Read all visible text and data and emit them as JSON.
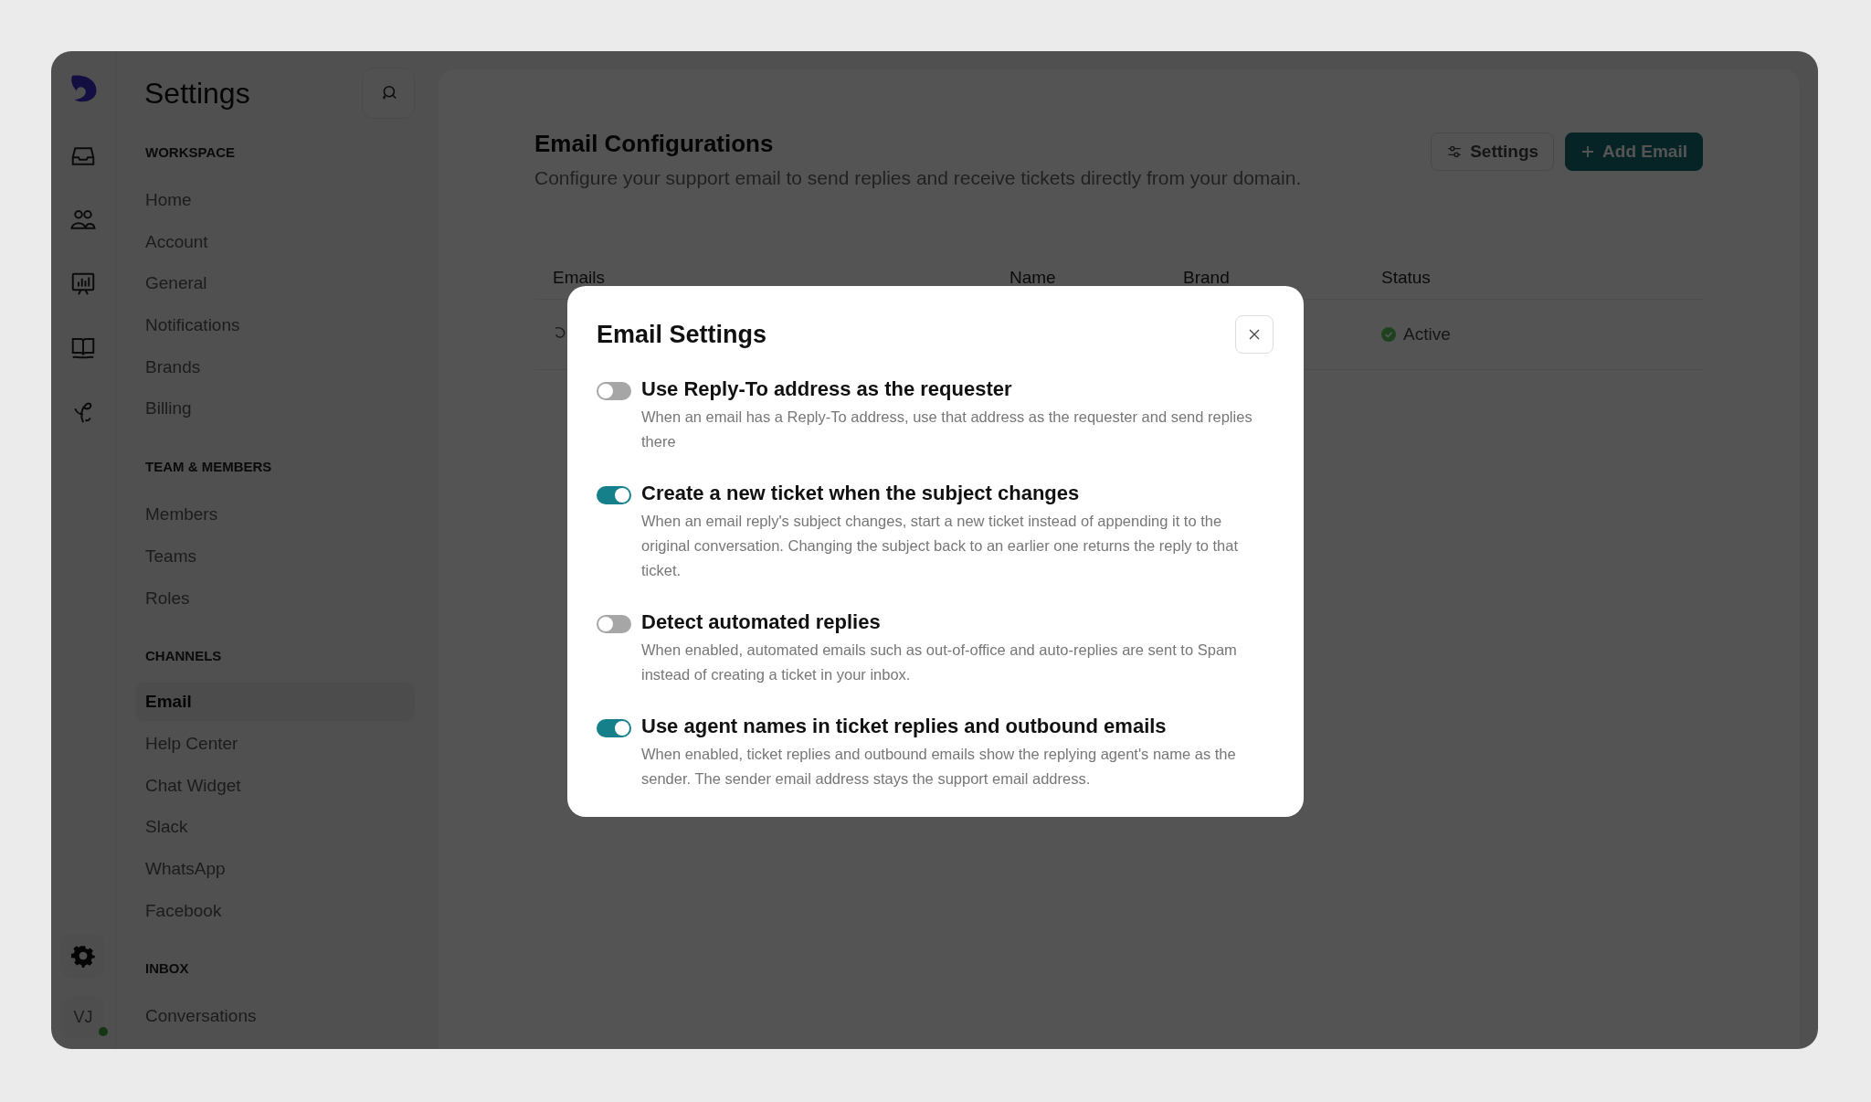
{
  "rail": {
    "avatar": "VJ"
  },
  "sidebar": {
    "title": "Settings",
    "sections": [
      {
        "heading": "WORKSPACE",
        "items": [
          {
            "label": "Home",
            "selected": false
          },
          {
            "label": "Account",
            "selected": false
          },
          {
            "label": "General",
            "selected": false
          },
          {
            "label": "Notifications",
            "selected": false
          },
          {
            "label": "Brands",
            "selected": false
          },
          {
            "label": "Billing",
            "selected": false
          }
        ]
      },
      {
        "heading": "TEAM & MEMBERS",
        "items": [
          {
            "label": "Members",
            "selected": false
          },
          {
            "label": "Teams",
            "selected": false
          },
          {
            "label": "Roles",
            "selected": false
          }
        ]
      },
      {
        "heading": "CHANNELS",
        "items": [
          {
            "label": "Email",
            "selected": true
          },
          {
            "label": "Help Center",
            "selected": false
          },
          {
            "label": "Chat Widget",
            "selected": false
          },
          {
            "label": "Slack",
            "selected": false
          },
          {
            "label": "WhatsApp",
            "selected": false
          },
          {
            "label": "Facebook",
            "selected": false
          }
        ]
      },
      {
        "heading": "INBOX",
        "items": [
          {
            "label": "Conversations",
            "selected": false
          }
        ]
      }
    ]
  },
  "main": {
    "title": "Email Configurations",
    "description": "Configure your support email to send replies and receive tickets directly from your domain.",
    "buttons": [
      {
        "label": "Settings",
        "kind": "secondary"
      },
      {
        "label": "Add Email",
        "kind": "primary"
      }
    ],
    "table": {
      "columns": [
        "Emails",
        "Name",
        "Brand",
        "Status"
      ],
      "rows": [
        {
          "status": "Active"
        }
      ]
    }
  },
  "dialog": {
    "title": "Email Settings",
    "options": [
      {
        "title": "Use Reply-To address as the requester",
        "description": "When an email has a Reply-To address, use that address as the requester and send replies there",
        "on": false
      },
      {
        "title": "Create a new ticket when the subject changes",
        "description": "When an email reply's subject changes, start a new ticket instead of appending it to the original conversation. Changing the subject back to an earlier one returns the reply to that ticket.",
        "on": true
      },
      {
        "title": "Detect automated replies",
        "description": "When enabled, automated emails such as out-of-office and auto-replies are sent to Spam instead of creating a ticket in your inbox.",
        "on": false
      },
      {
        "title": "Use agent names in ticket replies and outbound emails",
        "description": "When enabled, ticket replies and outbound emails show the replying agent's name as the sender. The sender email address stays the support email address.",
        "on": true
      }
    ]
  }
}
